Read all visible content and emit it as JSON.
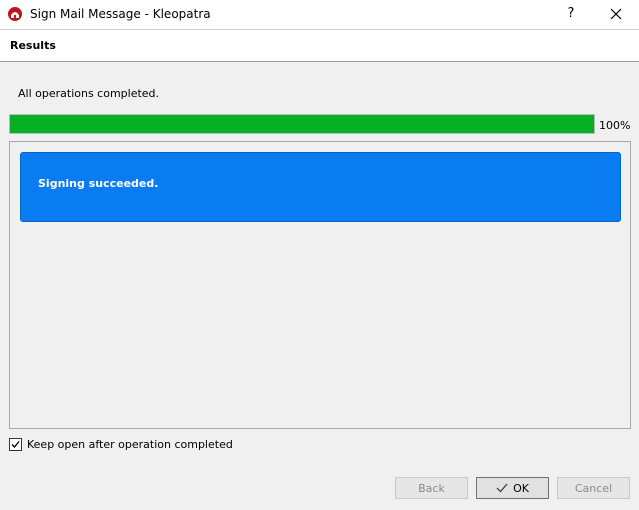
{
  "window": {
    "title": "Sign Mail Message - Kleopatra",
    "help_label": "?",
    "app_icon": "kleopatra-icon",
    "close_icon": "close-icon"
  },
  "page": {
    "title": "Results"
  },
  "status": {
    "text": "All operations completed.",
    "progress_percent": 100,
    "progress_label": "100%"
  },
  "results": [
    {
      "text": "Signing succeeded.",
      "color": "#0a7cf2"
    }
  ],
  "options": {
    "keep_open_label": "Keep open after operation completed",
    "keep_open_checked": true
  },
  "buttons": {
    "back": "Back",
    "ok": "OK",
    "cancel": "Cancel"
  },
  "colors": {
    "progress": "#06b025",
    "result_card": "#0a7cf2"
  }
}
